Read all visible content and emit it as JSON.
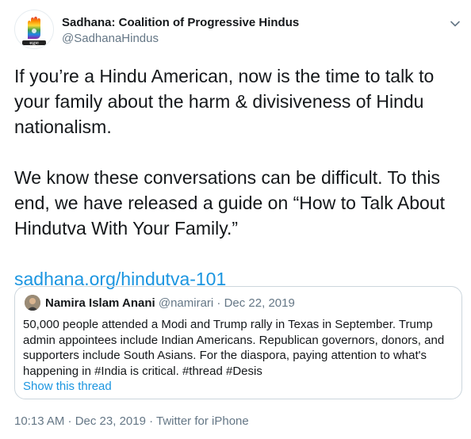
{
  "tweet": {
    "author_name": "Sadhana: Coalition of Progressive Hindus",
    "author_handle": "@SadhanaHindus",
    "avatar_text": "सद्धना",
    "paragraph1": "If you’re a Hindu American, now is the time to talk to your family about the harm & divisiveness of Hindu nationalism.",
    "paragraph2": "We know these conversations can be difficult. To this end, we have released a guide on “How to Talk About Hindutva With Your Family.”",
    "link": "sadhana.org/hindutva-101",
    "footer": "10:13 AM · Dec 23, 2019 · Twitter for iPhone"
  },
  "quoted": {
    "author_name": "Namira Islam Anani",
    "author_handle": "@namirari",
    "separator": " · ",
    "date": "Dec 22, 2019",
    "text": "50,000 people attended a Modi and Trump rally in Texas in September. Trump admin appointees include Indian Americans. Republican governors, donors, and supporters include South Asians. For the diaspora, paying attention to what's happening in #India is critical. #thread #Desis",
    "show_thread": "Show this thread"
  },
  "colors": {
    "link": "#1b95e0",
    "secondary_text": "#657786",
    "border": "#ccd6dd"
  },
  "icons": {
    "avatar": "rainbow-raised-hand-logo",
    "menu": "chevron-down-icon"
  }
}
